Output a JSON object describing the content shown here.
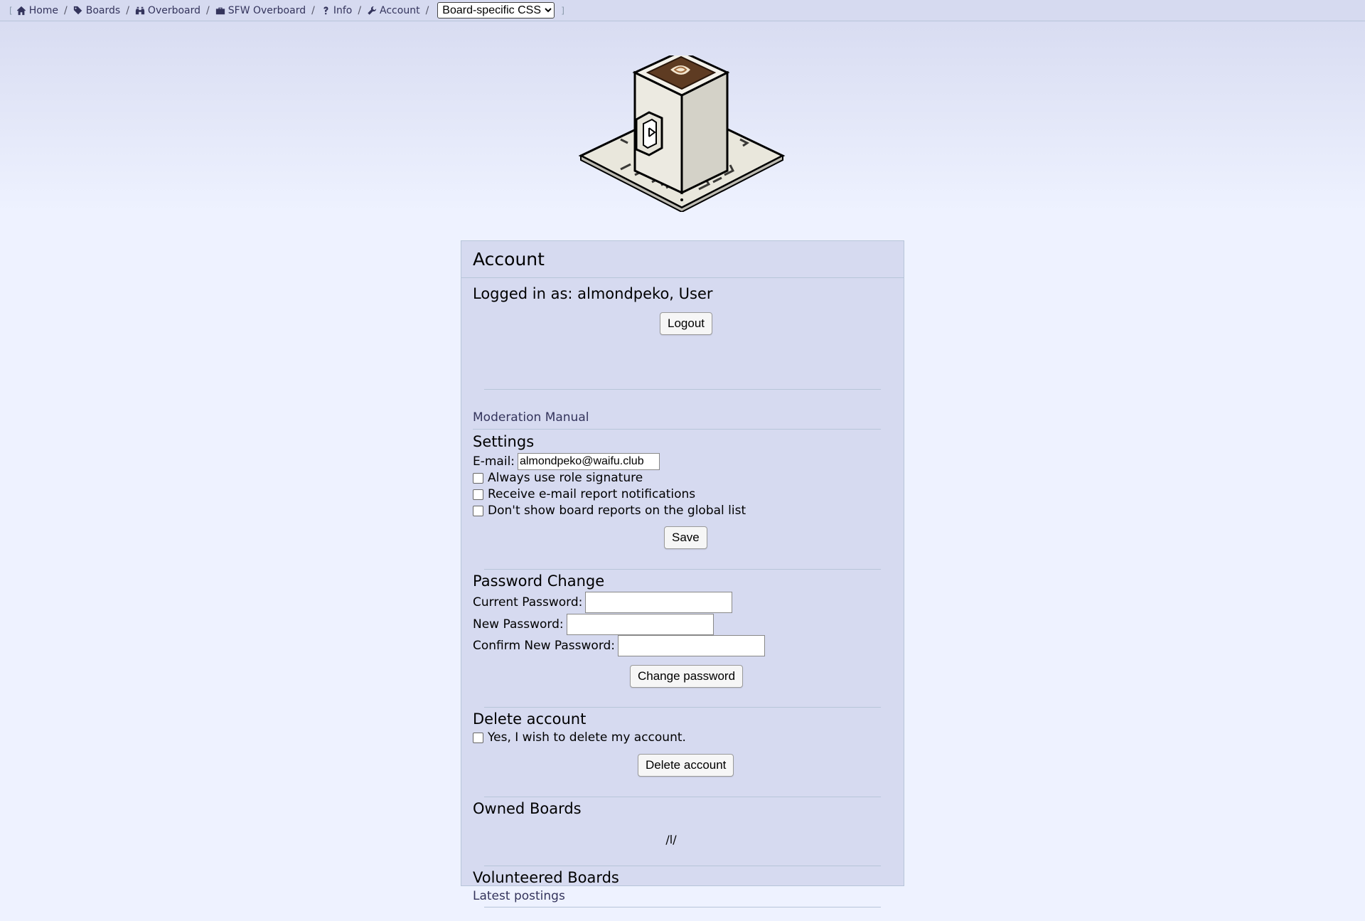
{
  "nav": {
    "items": [
      {
        "label": "Home",
        "icon": "home-icon"
      },
      {
        "label": "Boards",
        "icon": "tags-icon"
      },
      {
        "label": "Overboard",
        "icon": "binoculars-icon"
      },
      {
        "label": "SFW Overboard",
        "icon": "briefcase-icon"
      },
      {
        "label": "Info",
        "icon": "question-icon"
      },
      {
        "label": "Account",
        "icon": "wrench-icon"
      }
    ],
    "css_select": {
      "selected": "Board-specific CSS"
    },
    "bracket_open": "[",
    "bracket_close": "]",
    "separator": "/"
  },
  "logo": {
    "icon": "coffee-cup-logo"
  },
  "account": {
    "title": "Account",
    "logged_in_text": "Logged in as: almondpeko, User",
    "logout_label": "Logout",
    "moderation_manual_link": "Moderation Manual",
    "settings": {
      "heading": "Settings",
      "email_label": "E-mail:",
      "email_value": "almondpeko@waifu.club",
      "options": [
        {
          "label": "Always use role signature",
          "checked": false
        },
        {
          "label": "Receive e-mail report notifications",
          "checked": false
        },
        {
          "label": "Don't show board reports on the global list",
          "checked": false
        }
      ],
      "save_label": "Save"
    },
    "password": {
      "heading": "Password Change",
      "current_label": "Current Password:",
      "new_label": "New Password:",
      "confirm_label": "Confirm New Password:",
      "submit_label": "Change password"
    },
    "delete": {
      "heading": "Delete account",
      "confirm_label": "Yes, I wish to delete my account.",
      "submit_label": "Delete account"
    },
    "owned_boards": {
      "heading": "Owned Boards",
      "boards": [
        "/l/"
      ]
    },
    "volunteered_boards": {
      "heading": "Volunteered Boards",
      "latest_link": "Latest postings"
    }
  },
  "colors": {
    "accent": "#34345c",
    "panel_bg": "#d6daf0",
    "page_bg": "#eef2ff",
    "border": "#b7c5d9"
  }
}
